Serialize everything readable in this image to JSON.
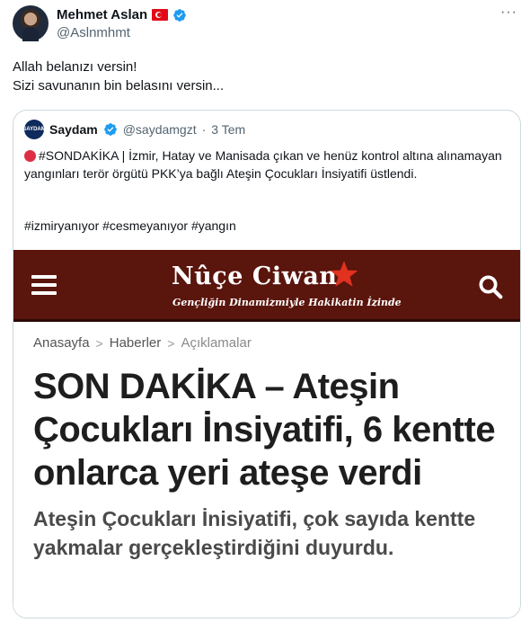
{
  "tweet": {
    "display_name": "Mehmet Aslan",
    "handle": "@Aslnmhmt",
    "text_line1": "Allah belanızı versin!",
    "text_line2": "Sizi savunanın bin belasını versin..."
  },
  "quote": {
    "avatar_text": "SAYDAM",
    "name": "Saydam",
    "handle": "@saydamgzt",
    "dot": "·",
    "time": "3 Tem",
    "text": "#SONDAKİKA | İzmir, Hatay ve Manisada çıkan ve henüz kontrol altına alınamayan yangınları terör örgütü PKK’ya bağlı Ateşin Çocukları İnsiyatifi üstlendi.",
    "hashtags": "#izmiryanıyor #cesmeyanıyor #yangın"
  },
  "article": {
    "site_name": "Nûçe Ciwan",
    "tagline": "Gençliğin Dinamizmiyle Hakikatin İzinde",
    "breadcrumb": [
      "Anasayfa",
      "Haberler",
      "Açıklamalar"
    ],
    "breadcrumb_sep": ">",
    "title": "SON DAKİKA – Ateşin Çocukları İnsiyatifi, 6 kentte onlarca yeri ateşe verdi",
    "subtitle": "Ateşin Çocukları İnisiyatifi, çok sayıda kentte yakmalar gerçekleştirdiğini duyurdu."
  },
  "colors": {
    "site_bar": "#5a150d",
    "star": "#e0321f",
    "verified": "#1d9bf0"
  }
}
